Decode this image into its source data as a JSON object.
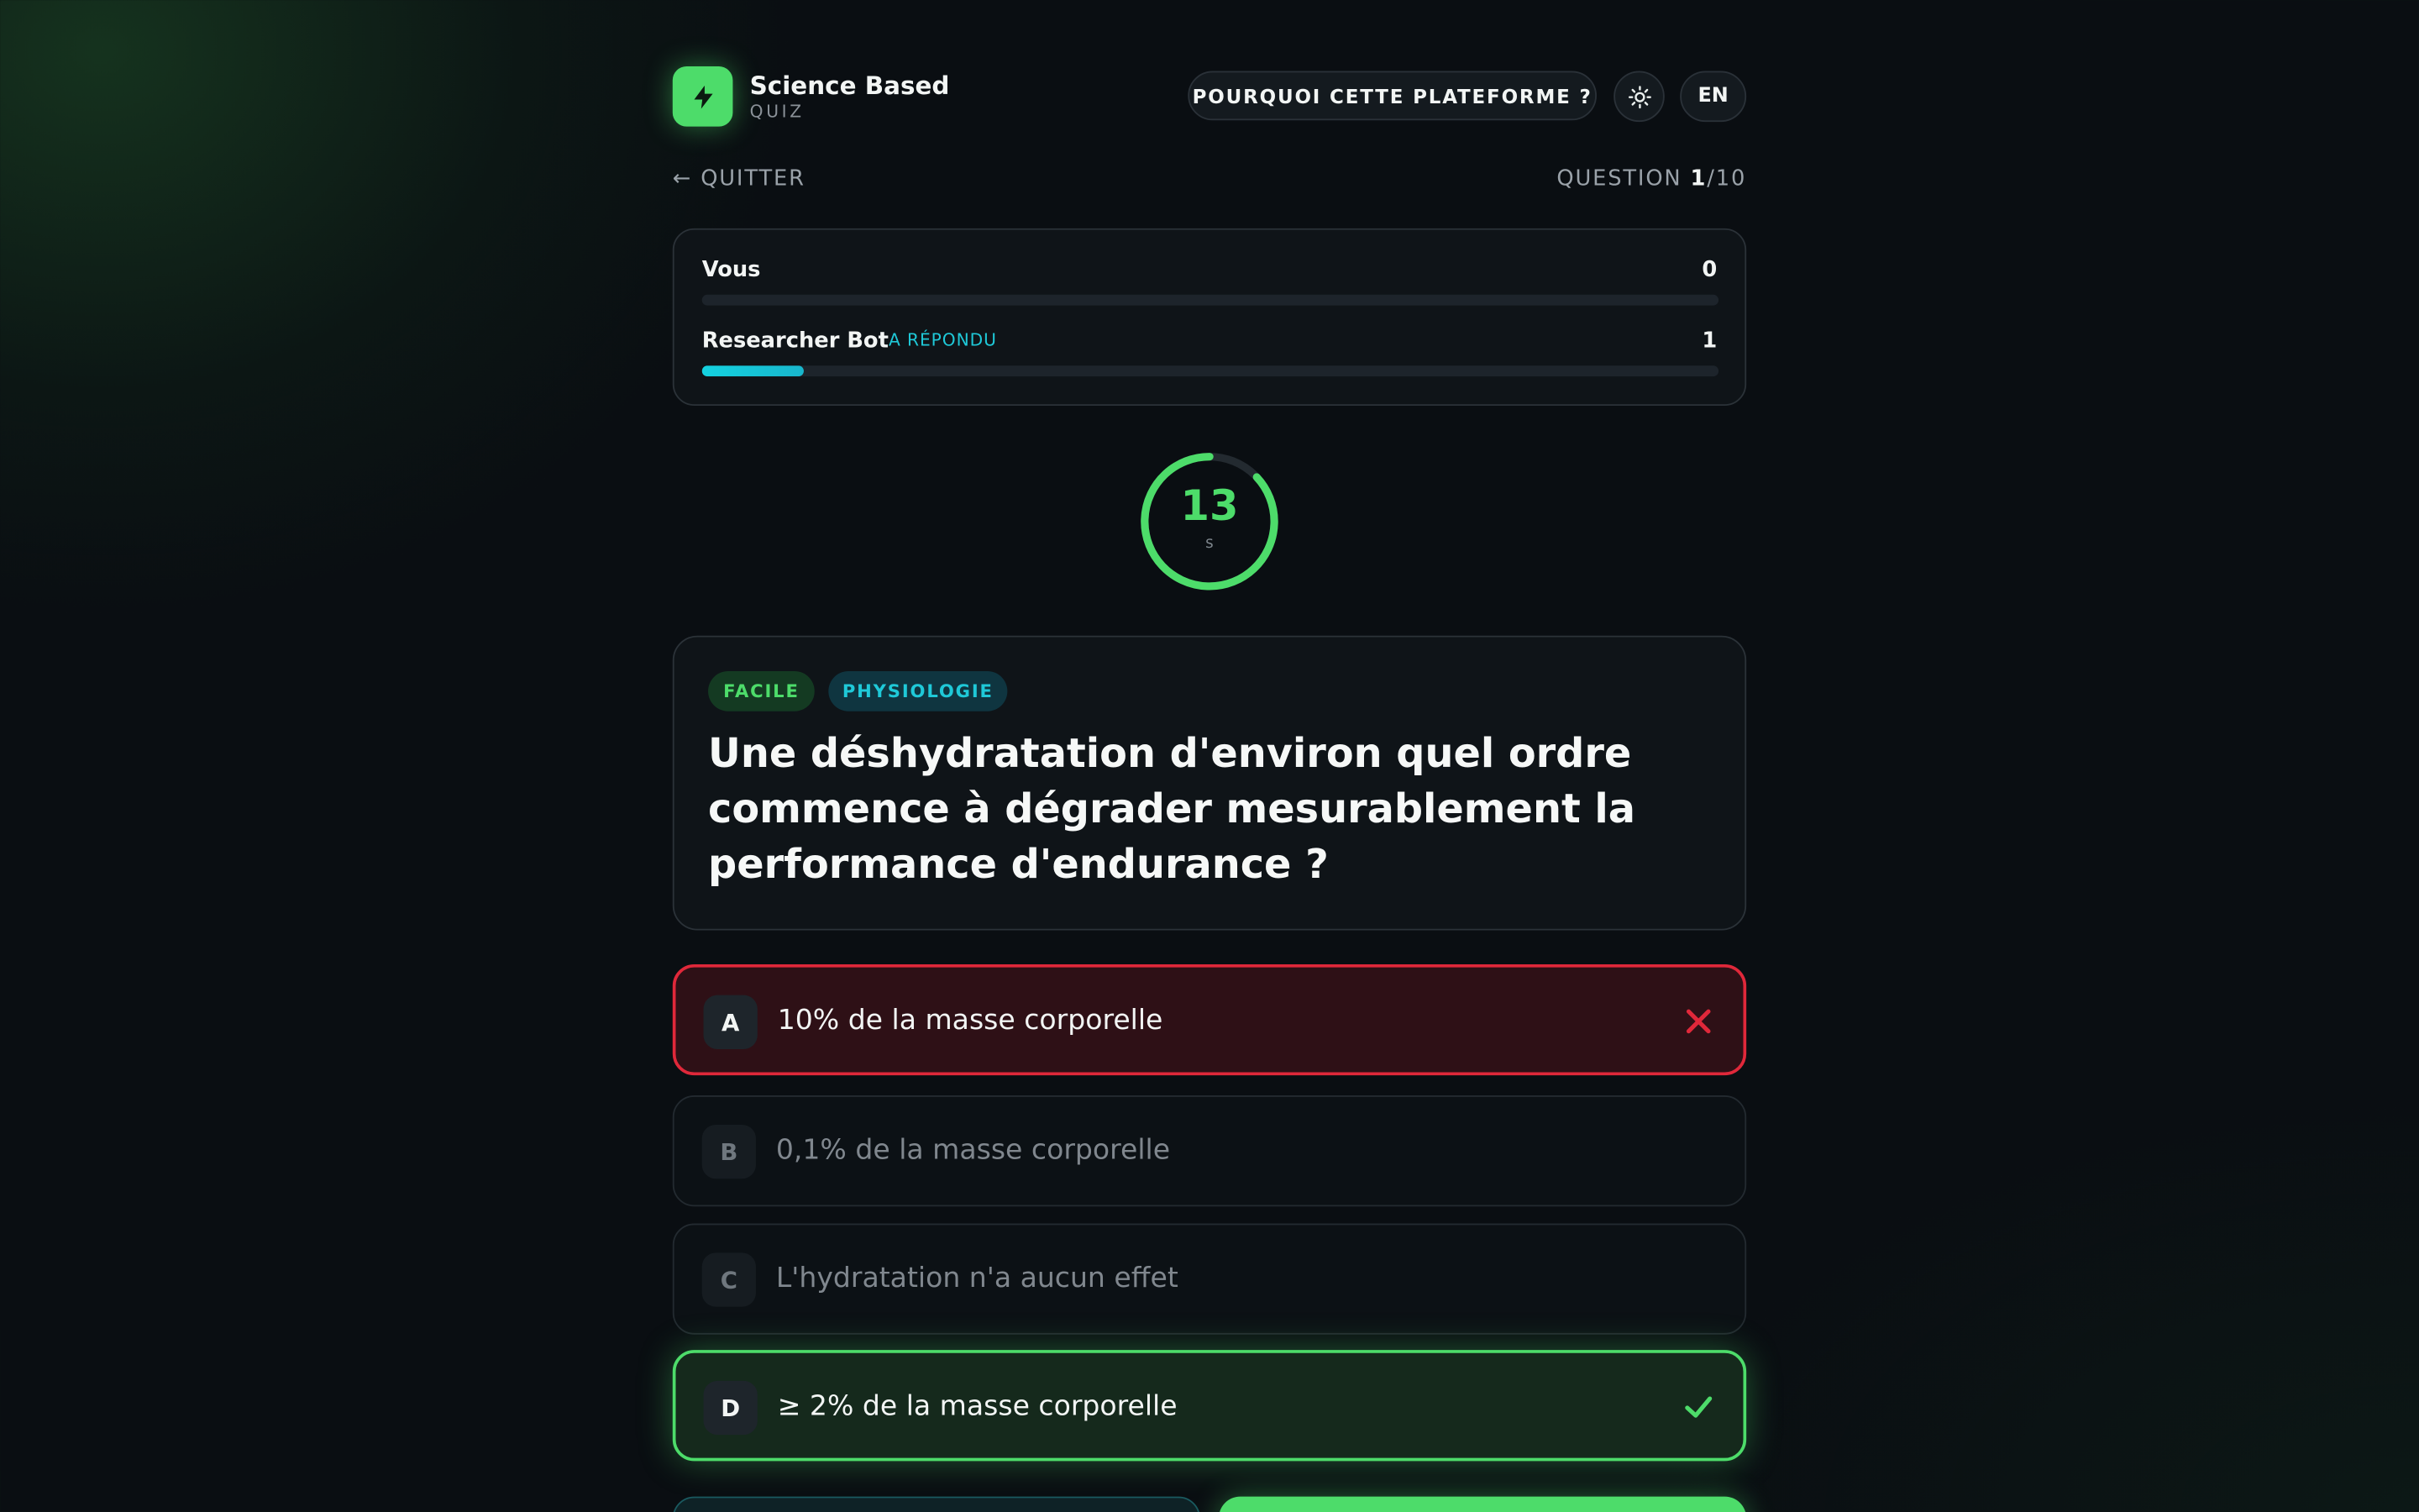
{
  "header": {
    "brand_name": "Science Based",
    "brand_sub": "QUIZ",
    "why_button": "POURQUOI CETTE PLATEFORME ?",
    "theme_icon": "sun-icon",
    "lang_button": "EN"
  },
  "nav": {
    "quit_label": "← QUITTER",
    "question_prefix": "QUESTION ",
    "question_current": "1",
    "question_total": "/10"
  },
  "scoreboard": {
    "players": [
      {
        "name": "Vous",
        "score": "0",
        "progress": 0
      },
      {
        "name": "Researcher Bot",
        "badge": "A RÉPONDU",
        "score": "1",
        "progress": 0.1
      }
    ]
  },
  "timer": {
    "value": "13",
    "unit": "s",
    "remaining_fraction": 0.87
  },
  "question": {
    "level_tag": "FACILE",
    "topic_tag": "PHYSIOLOGIE",
    "text": "Une déshydratation d'environ quel ordre commence à dégrader mesurablement la performance d'endurance ?"
  },
  "options": [
    {
      "letter": "A",
      "text": "10% de la masse corporelle",
      "state": "wrong"
    },
    {
      "letter": "B",
      "text": "0,1% de la masse corporelle",
      "state": "neutral"
    },
    {
      "letter": "C",
      "text": "L'hydratation n'a aucun effet",
      "state": "neutral"
    },
    {
      "letter": "D",
      "text": "≥ 2% de la masse corporelle",
      "state": "correct"
    }
  ],
  "colors": {
    "accent_green": "#4ddc6a",
    "accent_cyan": "#14d2e0",
    "error_red": "#e0283a",
    "background": "#0a0e12"
  }
}
